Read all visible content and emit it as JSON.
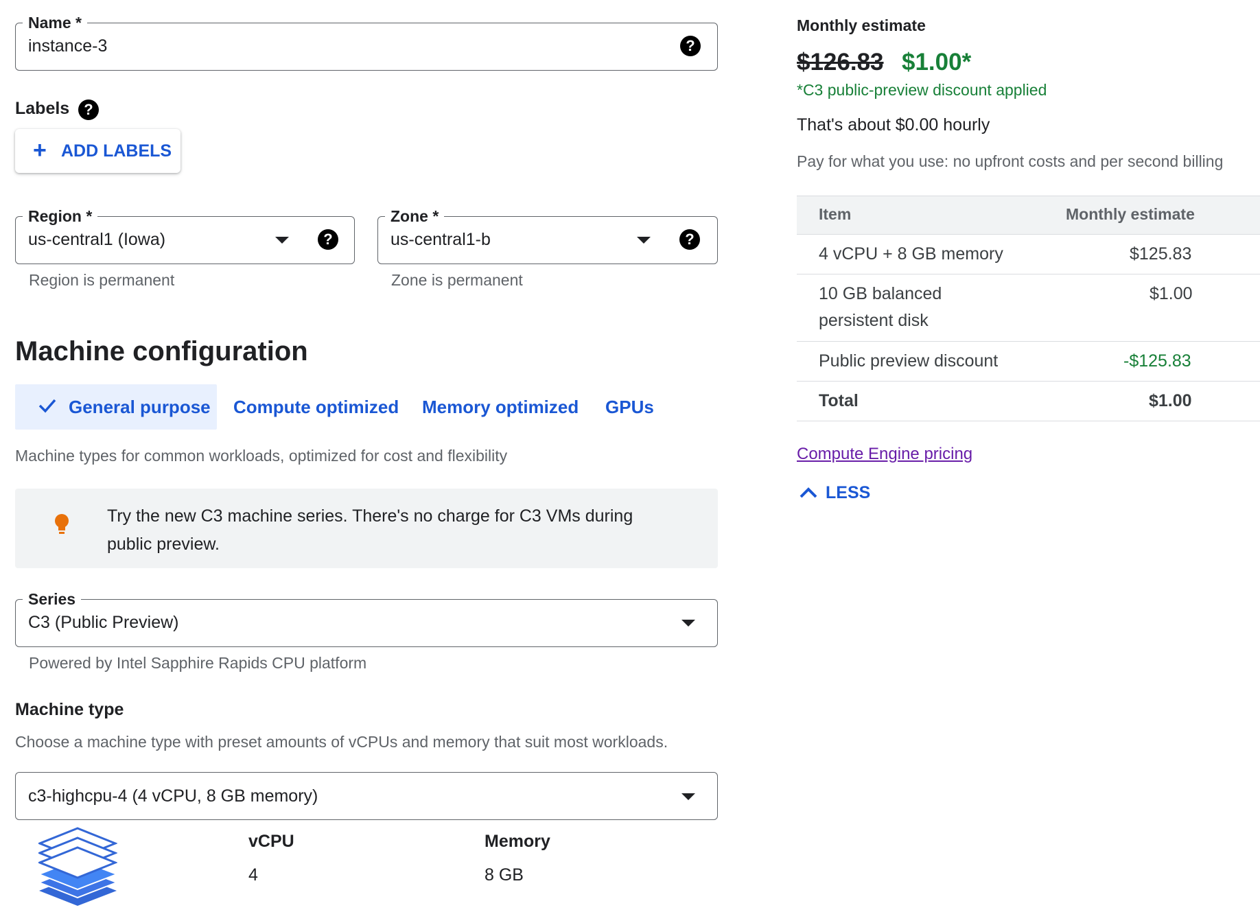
{
  "name_field": {
    "label": "Name *",
    "value": "instance-3"
  },
  "labels": {
    "title": "Labels",
    "add_button": "ADD LABELS"
  },
  "region": {
    "label": "Region *",
    "value": "us-central1 (Iowa)",
    "hint": "Region is permanent"
  },
  "zone": {
    "label": "Zone *",
    "value": "us-central1-b",
    "hint": "Zone is permanent"
  },
  "machine_config": {
    "title": "Machine configuration",
    "tabs": [
      {
        "label": "General purpose",
        "selected": true
      },
      {
        "label": "Compute optimized"
      },
      {
        "label": "Memory optimized"
      },
      {
        "label": "GPUs"
      }
    ],
    "description": "Machine types for common workloads, optimized for cost and flexibility",
    "info_banner": "Try the new C3 machine series. There's no charge for C3 VMs during public preview."
  },
  "series": {
    "label": "Series",
    "value": "C3 (Public Preview)",
    "hint": "Powered by Intel Sapphire Rapids CPU platform"
  },
  "machine_type": {
    "title": "Machine type",
    "description": "Choose a machine type with preset amounts of vCPUs and memory that suit most workloads.",
    "value": "c3-highcpu-4 (4 vCPU, 8 GB memory)",
    "vcpu_label": "vCPU",
    "vcpu_value": "4",
    "memory_label": "Memory",
    "memory_value": "8 GB"
  },
  "estimate": {
    "title": "Monthly estimate",
    "old_price": "$126.83",
    "new_price": "$1.00*",
    "discount_note": "*C3 public-preview discount applied",
    "hourly": "That's about $0.00 hourly",
    "billing_note": "Pay for what you use: no upfront costs and per second billing",
    "table": {
      "headers": [
        "Item",
        "Monthly estimate"
      ],
      "rows": [
        {
          "item": "4 vCPU + 8 GB memory",
          "cost": "$125.83"
        },
        {
          "item_line1": "10 GB balanced",
          "item_line2": "persistent disk",
          "cost": "$1.00"
        },
        {
          "item": "Public preview discount",
          "cost": "-$125.83"
        }
      ],
      "total_label": "Total",
      "total_value": "$1.00"
    },
    "pricing_link": "Compute Engine pricing",
    "less_label": "LESS"
  },
  "colors": {
    "accent_blue": "#1a57d4",
    "green": "#188038",
    "link_purple": "#681da8",
    "bulb_orange": "#e8710a"
  }
}
